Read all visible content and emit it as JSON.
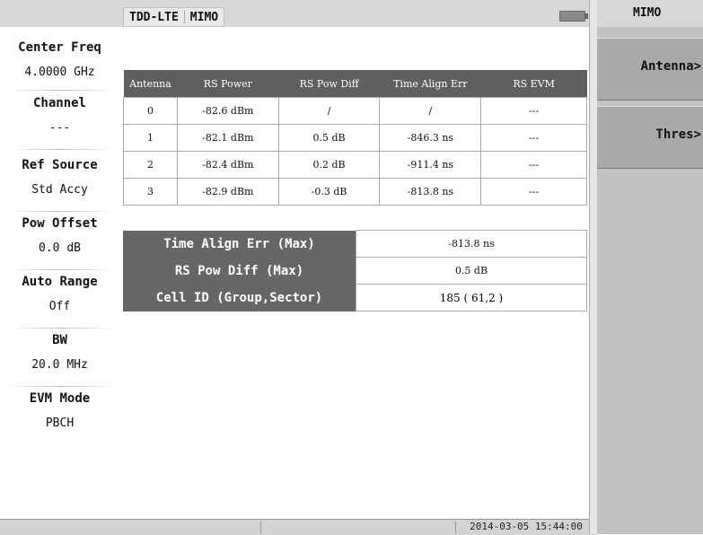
{
  "header": {
    "mode": "TDD-LTE",
    "submode": "MIMO"
  },
  "left_panel": [
    {
      "label": "Center Freq",
      "value": "4.0000 GHz"
    },
    {
      "label": "Channel",
      "value": "---"
    },
    {
      "label": "Ref Source",
      "value": "Std Accy"
    },
    {
      "label": "Pow Offset",
      "value": "0.0 dB"
    },
    {
      "label": "Auto Range",
      "value": "Off"
    },
    {
      "label": "BW",
      "value": "20.0 MHz"
    },
    {
      "label": "EVM Mode",
      "value": "PBCH"
    }
  ],
  "table": {
    "headers": [
      "Antenna",
      "RS Power",
      "RS Pow Diff",
      "Time Align Err",
      "RS EVM"
    ],
    "rows": [
      [
        "0",
        "-82.6 dBm",
        "/",
        "/",
        "---"
      ],
      [
        "1",
        "-82.1 dBm",
        "0.5 dB",
        "-846.3 ns",
        "---"
      ],
      [
        "2",
        "-82.4 dBm",
        "0.2 dB",
        "-911.4 ns",
        "---"
      ],
      [
        "3",
        "-82.9 dBm",
        "-0.3 dB",
        "-813.8 ns",
        "---"
      ]
    ]
  },
  "summary": [
    {
      "label": "Time Align Err (Max)",
      "value": "-813.8 ns"
    },
    {
      "label": "RS Pow Diff (Max)",
      "value": "0.5 dB"
    },
    {
      "label": "Cell ID (Group,Sector)",
      "value": "185 ( 61,2 )"
    }
  ],
  "status": {
    "datetime": "2014-03-05 15:44:00"
  },
  "right_panel": {
    "title": "MIMO",
    "keys": [
      {
        "label": "Antenna>"
      },
      {
        "label": "Thres>"
      }
    ]
  }
}
